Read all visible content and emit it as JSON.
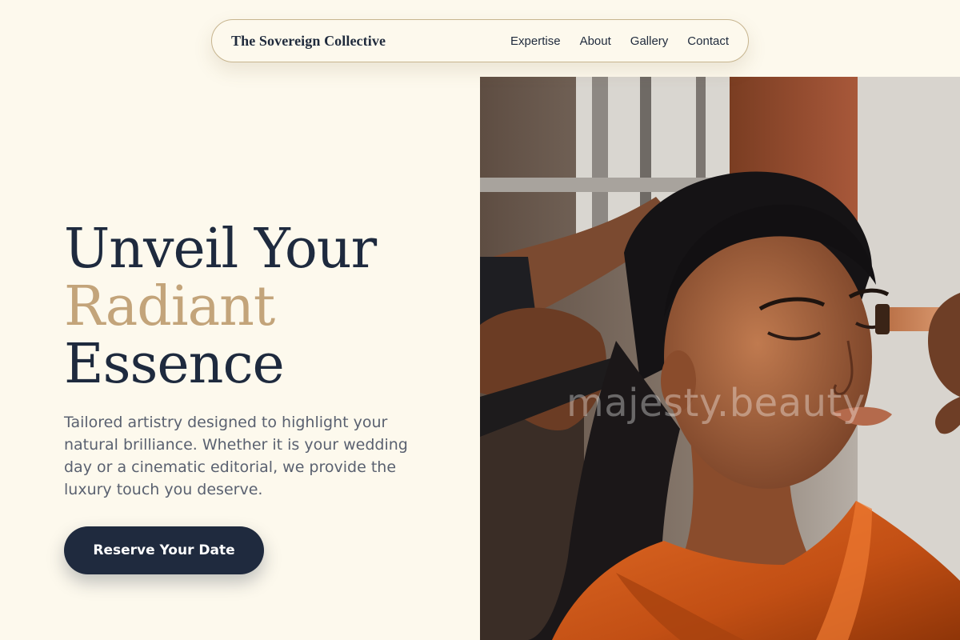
{
  "nav": {
    "brand": "The Sovereign Collective",
    "links": [
      "Expertise",
      "About",
      "Gallery",
      "Contact"
    ]
  },
  "hero": {
    "title_line1": "Unveil Your",
    "title_line2": "Radiant",
    "title_line3": "Essence",
    "description": "Tailored artistry designed to highlight your natural brilliance. Whether it is your wedding day or a cinematic editorial, we provide the luxury touch you deserve.",
    "cta_label": "Reserve Your Date"
  },
  "photo": {
    "watermark": "majesty.beauty",
    "subject": "makeup-artist-applying-makeup-to-woman"
  },
  "colors": {
    "background": "#fdf9ed",
    "navy": "#1e2a3e",
    "gold_accent": "#c3a47a",
    "body_text": "#5a6170",
    "nav_border": "#c7b58f"
  }
}
